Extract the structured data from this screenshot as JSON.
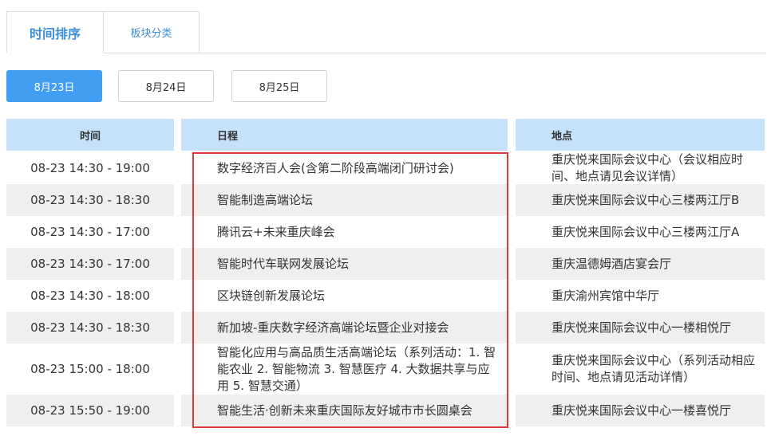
{
  "tabs": {
    "time_sort": "时间排序",
    "section_category": "板块分类"
  },
  "dates": [
    "8月23日",
    "8月24日",
    "8月25日"
  ],
  "table": {
    "headers": {
      "time": "时间",
      "schedule": "日程",
      "location": "地点"
    },
    "rows": [
      {
        "time": "08-23 14:30 - 19:00",
        "schedule": "数字经济百人会(含第二阶段高端闭门研讨会)",
        "location": "重庆悦来国际会议中心（会议相应时间、地点请见会议详情）"
      },
      {
        "time": "08-23 14:30 - 18:30",
        "schedule": "智能制造高端论坛",
        "location": "重庆悦来国际会议中心三楼两江厅B"
      },
      {
        "time": "08-23 14:30 - 17:00",
        "schedule": "腾讯云+未来重庆峰会",
        "location": "重庆悦来国际会议中心三楼两江厅A"
      },
      {
        "time": "08-23 14:30 - 17:00",
        "schedule": "智能时代车联网发展论坛",
        "location": "重庆温德姆酒店宴会厅"
      },
      {
        "time": "08-23 14:30 - 18:00",
        "schedule": "区块链创新发展论坛",
        "location": "重庆渝州宾馆中华厅"
      },
      {
        "time": "08-23 14:30 - 18:30",
        "schedule": "新加坡-重庆数字经济高端论坛暨企业对接会",
        "location": "重庆悦来国际会议中心一楼相悦厅"
      },
      {
        "time": "08-23 15:00 - 18:00",
        "schedule": "智能化应用与高品质生活高端论坛（系列活动：1. 智能农业 2. 智能物流 3. 智慧医疗 4. 大数据共享与应用 5. 智慧交通）",
        "location": "重庆悦来国际会议中心（系列活动相应时间、地点请见活动详情）"
      },
      {
        "time": "08-23 15:50 - 19:00",
        "schedule": "智能生活·创新未来重庆国际友好城市市长圆桌会",
        "location": "重庆悦来国际会议中心一楼喜悦厅"
      }
    ]
  },
  "colors": {
    "accent": "#419ef2",
    "header_bg": "#c5e2fa",
    "row_shade": "#efefef",
    "highlight": "#e03a3a"
  }
}
